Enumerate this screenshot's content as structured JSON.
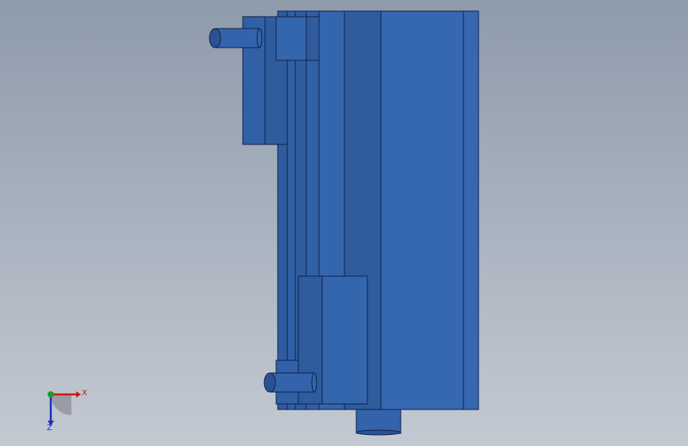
{
  "viewport": {
    "colors": {
      "face_main": "#3568b0",
      "face_mid": "#3060a6",
      "face_shaded": "#2e5c9e",
      "face_light": "#3a6db5",
      "edge": "#12204a",
      "shaft": "#3363ab",
      "shaft_end": "#2a5294"
    }
  },
  "triad": {
    "x_label": "X",
    "z_label": "Z",
    "x_color": "#c81818",
    "y_color": "#1f9a2a",
    "z_color": "#1a2fb8"
  }
}
